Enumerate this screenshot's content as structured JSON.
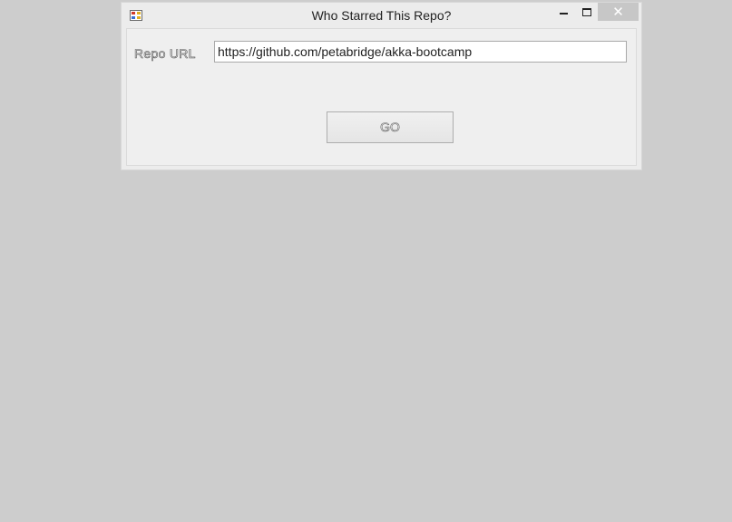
{
  "window": {
    "title": "Who Starred This Repo?",
    "close_symbol": "✕"
  },
  "form": {
    "repo_url_label": "Repo URL",
    "repo_url_value": "https://github.com/petabridge/akka-bootcamp",
    "go_label": "GO"
  },
  "icons": {
    "app": "app-icon",
    "minimize": "minimize-icon",
    "maximize": "maximize-icon",
    "close": "close-icon"
  },
  "colors": {
    "desktop": "#cdcdcd",
    "window": "#ececec",
    "close_button": "#c7c7c7"
  }
}
